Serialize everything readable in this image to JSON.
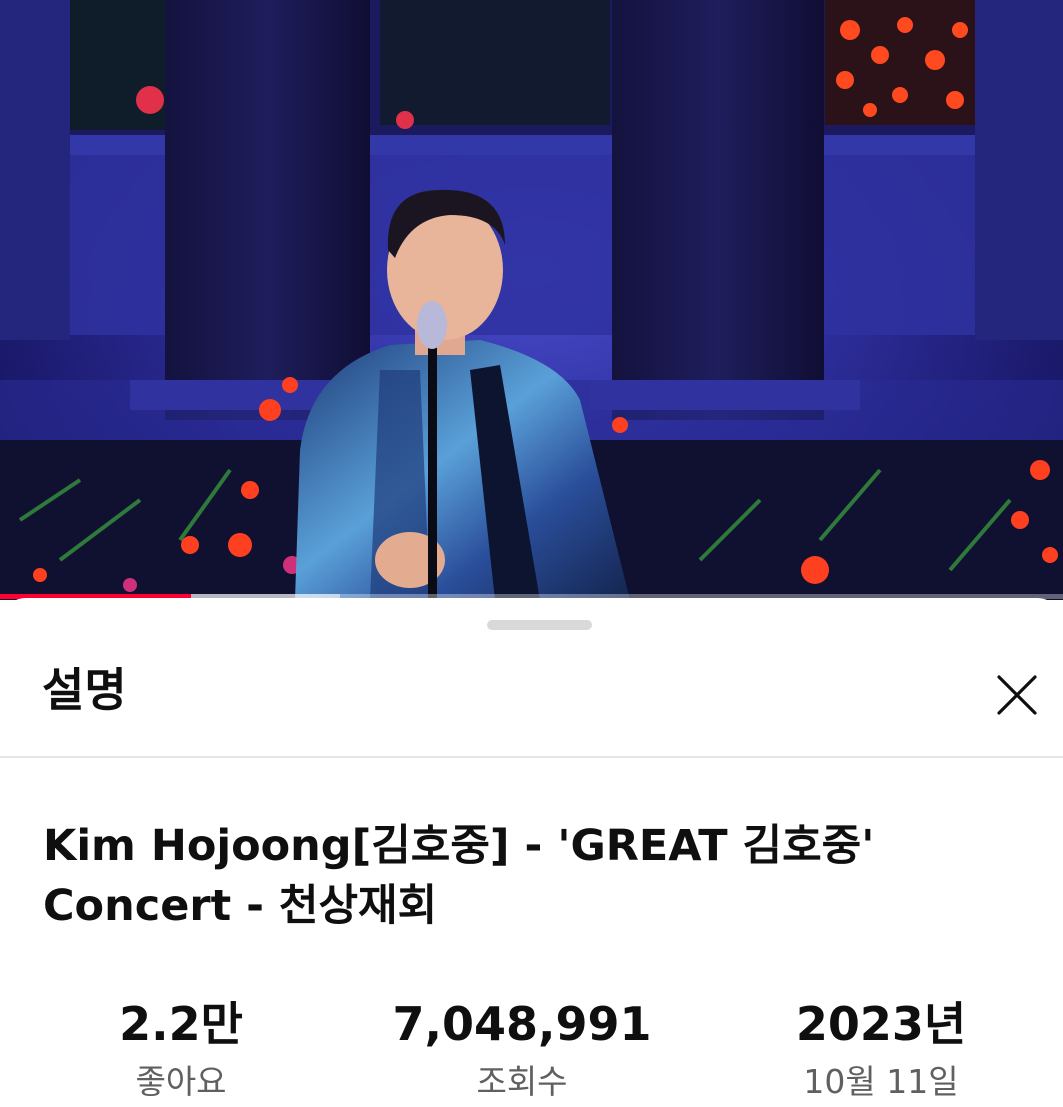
{
  "player": {
    "progress_played": 0.18,
    "progress_buffered": 0.32,
    "accent_color": "#ff0033"
  },
  "description_panel": {
    "title": "설명",
    "close_icon": "close-icon",
    "video_title": "Kim Hojoong[김호중] - 'GREAT 김호중' Concert - 천상재회",
    "stats": {
      "likes": {
        "value": "2.2만",
        "label": "좋아요"
      },
      "views": {
        "value": "7,048,991",
        "label": "조회수"
      },
      "date": {
        "value": "2023년",
        "label": "10월 11일"
      }
    }
  }
}
